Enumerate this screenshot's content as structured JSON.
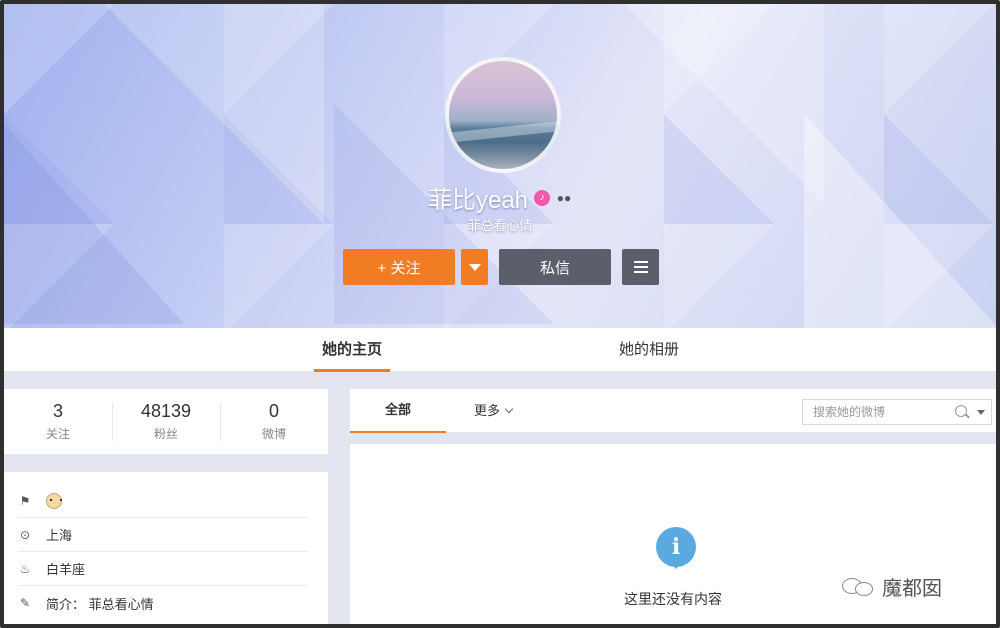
{
  "profile": {
    "name": "菲比yeah",
    "bio": "菲总看心情",
    "member_badge_icon": "vip-member-icon",
    "extra_badge_icon": "badge-eyes-icon"
  },
  "actions": {
    "follow_label": "+ 关注",
    "message_label": "私信"
  },
  "tabs": [
    {
      "label": "她的主页",
      "active": true
    },
    {
      "label": "她的相册",
      "active": false
    }
  ],
  "stats": [
    {
      "value": "3",
      "label": "关注"
    },
    {
      "value": "48139",
      "label": "粉丝"
    },
    {
      "value": "0",
      "label": "微博"
    }
  ],
  "info": {
    "location": "上海",
    "zodiac": "白羊座",
    "intro": "简介：  菲总看心情"
  },
  "feed": {
    "tab_all": "全部",
    "tab_more": "更多",
    "search_placeholder": "搜索她的微博",
    "empty_text": "这里还没有内容"
  },
  "watermark": {
    "text": "魔都囡"
  },
  "colors": {
    "accent_orange": "#f27c23",
    "dark_button": "#5b5f6c",
    "info_blue": "#5aa9e0",
    "badge_pink": "#f25aa9"
  }
}
